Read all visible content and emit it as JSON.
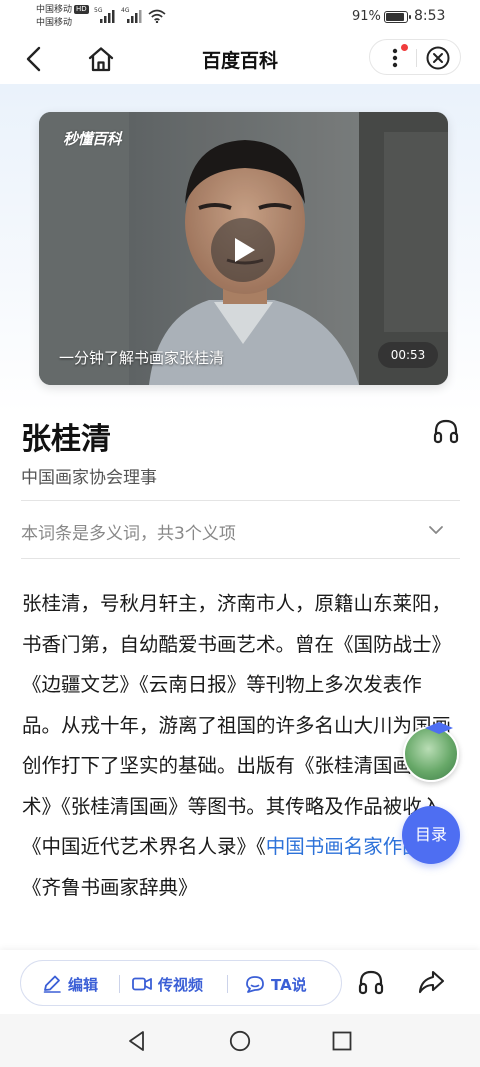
{
  "status_bar": {
    "carrier_1": "中国移动",
    "carrier_1_badge": "HD",
    "carrier_2": "中国移动",
    "network_1": "5G",
    "network_2": "4G",
    "battery_percent": "91%",
    "battery_level": 0.91,
    "time": "8:53"
  },
  "nav": {
    "title": "百度百科",
    "icons": [
      "back-arrow-icon",
      "home-icon",
      "more-dots-icon",
      "close-circle-icon"
    ],
    "notification_dot_color": "#f03c3c"
  },
  "video": {
    "logo_text": "秒懂百科",
    "caption": "一分钟了解书画家张桂清",
    "duration": "00:53"
  },
  "entry": {
    "name": "张桂清",
    "subtitle": "中国画家协会理事",
    "polysemy_note": "本词条是多义词，共3个义项"
  },
  "summary": {
    "text_before_link": "张桂清，号秋月轩主，济南市人，原籍山东莱阳，书香门第，自幼酷爱书画艺术。曾在《国防战士》《边疆文艺》《云南日报》等刊物上多次发表作品。从戎十年，游离了祖国的许多名山大川为国画创作打下了坚实的基础。出版有《张桂清国画艺术》《张桂清国画》等图书。其传略及作品被收入《中国近代艺术界名人录》《",
    "link_text": "中国书画名家作品集",
    "text_after_link": "》《齐鲁书画家辞典》"
  },
  "toc_button": "目录",
  "actions": {
    "edit": "编辑",
    "upload_video": "传视频",
    "ta_says": "TA说"
  },
  "colors": {
    "accent_blue": "#4e6ef2",
    "link_blue": "#2d72d9",
    "action_text": "#3b5fd6"
  }
}
